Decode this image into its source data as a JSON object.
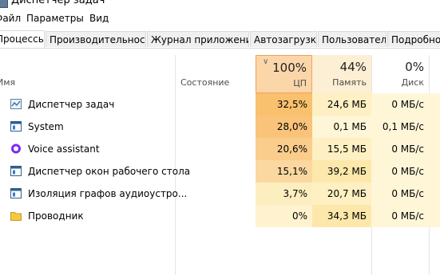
{
  "window": {
    "title": "Диспетчер задач"
  },
  "menu": [
    "Файл",
    "Параметры",
    "Вид"
  ],
  "tabs": [
    "Процессы",
    "Производительность",
    "Журнал приложений",
    "Автозагрузка",
    "Пользователи",
    "Подробно"
  ],
  "active_tab": 0,
  "columns": {
    "name": "Имя",
    "status": "Состояние",
    "cpu": {
      "percent": "100%",
      "label": "ЦП"
    },
    "memory": {
      "percent": "44%",
      "label": "Память"
    },
    "disk": {
      "percent": "0%",
      "label": "Диск"
    }
  },
  "processes": [
    {
      "name": "Диспетчер задач",
      "icon": "task-manager-icon",
      "cpu": "32,5%",
      "memory": "24,6 МБ",
      "disk": "0 МБ/с"
    },
    {
      "name": "System",
      "icon": "window-icon",
      "cpu": "28,0%",
      "memory": "0,1 МБ",
      "disk": "0,1 МБ/с"
    },
    {
      "name": "Voice assistant",
      "icon": "voice-assistant-icon",
      "cpu": "20,6%",
      "memory": "15,5 МБ",
      "disk": "0 МБ/с"
    },
    {
      "name": "Диспетчер окон рабочего стола",
      "icon": "window-icon",
      "cpu": "15,1%",
      "memory": "39,2 МБ",
      "disk": "0 МБ/с"
    },
    {
      "name": "Изоляция графов аудиоустро...",
      "icon": "window-icon",
      "cpu": "3,7%",
      "memory": "20,7 МБ",
      "disk": "0 МБ/с"
    },
    {
      "name": "Проводник",
      "icon": "folder-icon",
      "cpu": "0%",
      "memory": "34,3 МБ",
      "disk": "0 МБ/с"
    }
  ],
  "colors": {
    "cpu_header_bg": "#fbd6a9",
    "cpu_header_border": "#f0a160",
    "memory_header_bg": "#fcefd4",
    "cpu_cells": [
      "#f9c06e",
      "#f9c37a",
      "#fbcd8c",
      "#fbd89f",
      "#fdeec0",
      "#fff3cf"
    ],
    "memory_cells": [
      "#fef0c2",
      "#fff6d8",
      "#fef0c2",
      "#fde8ab",
      "#fef0c2",
      "#fde8ab"
    ],
    "disk_cells": "#fff6d8",
    "voice_icon": "#7b2cf0"
  }
}
